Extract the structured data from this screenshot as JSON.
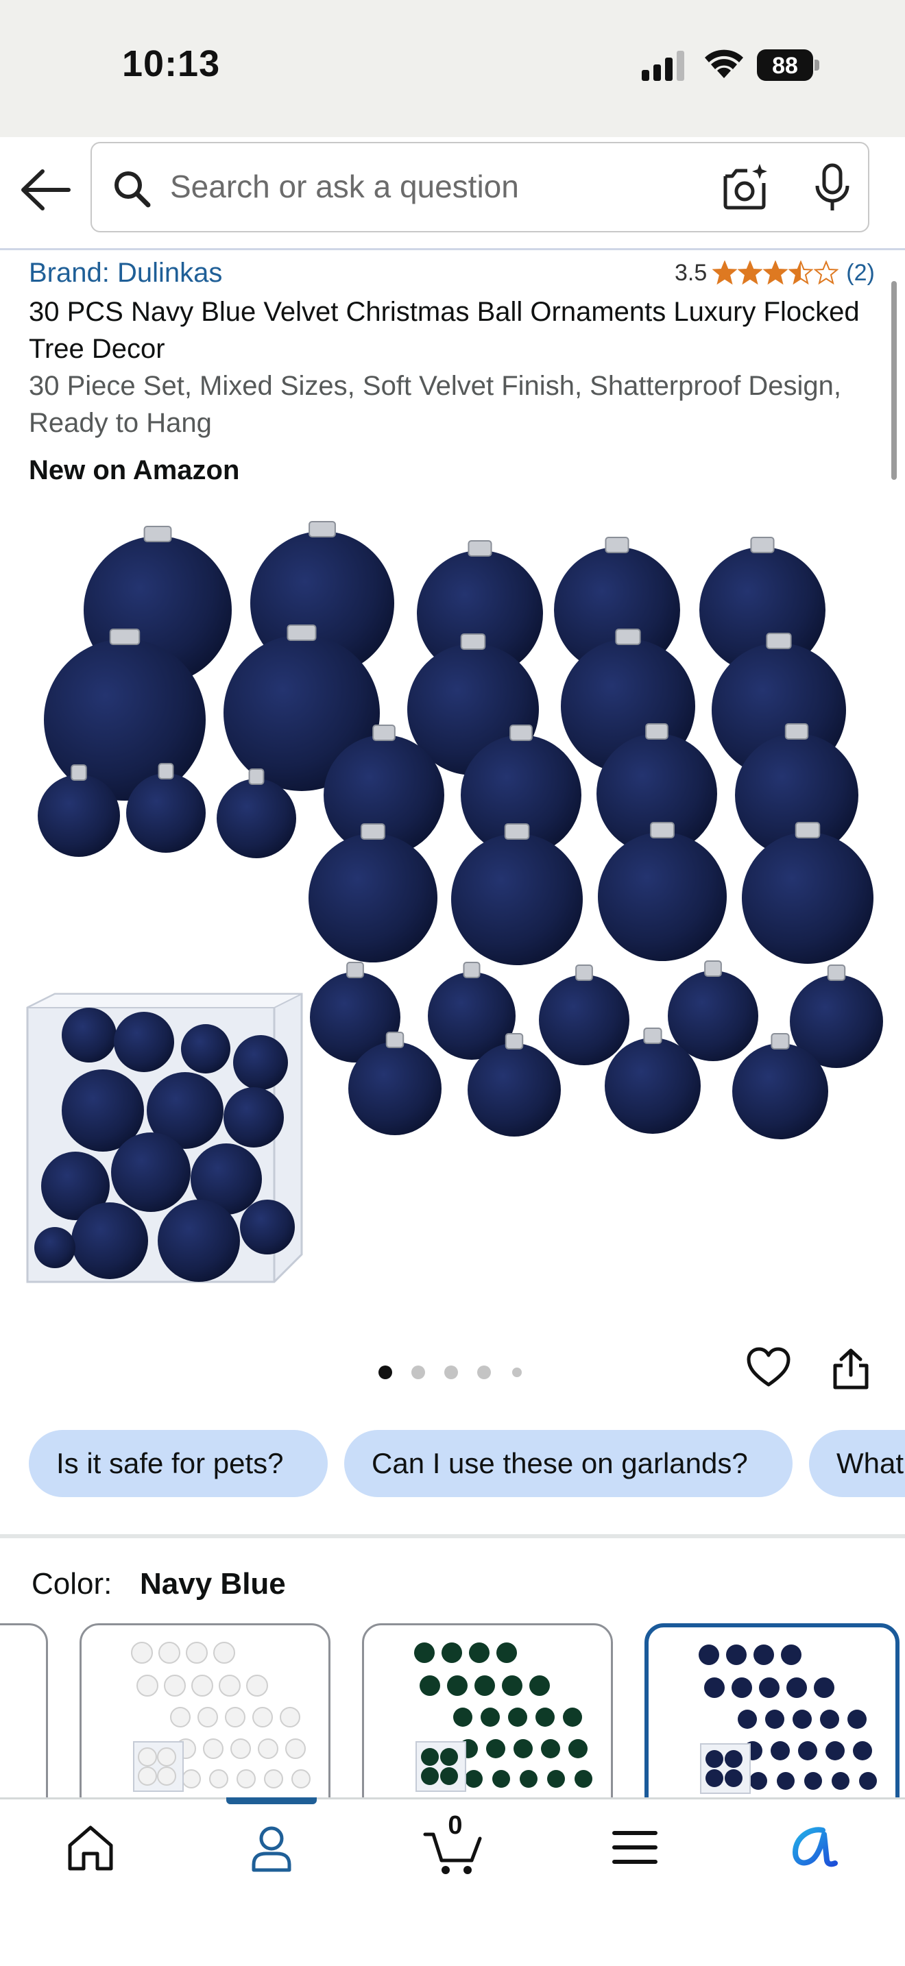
{
  "status_bar": {
    "time": "10:13",
    "battery": "88"
  },
  "search": {
    "placeholder": "Search or ask a question"
  },
  "product": {
    "brand": "Brand: Dulinkas",
    "rating": "3.5",
    "rating_stars": 3.5,
    "rating_count": "(2)",
    "title": "30 PCS Navy Blue Velvet Christmas Ball Ornaments Luxury Flocked Tree Decor",
    "subtitle": "30 Piece Set, Mixed Sizes, Soft Velvet Finish, Shatterproof Design, Ready to Hang",
    "badge": "New on Amazon",
    "image_pages": 5,
    "active_page": 1
  },
  "questions": [
    "Is it safe for pets?",
    "Can I use these on garlands?",
    "What"
  ],
  "color": {
    "label": "Color:",
    "selected": "Navy Blue",
    "swatches": [
      {
        "name": "white",
        "ball_color": "#f2f2f2"
      },
      {
        "name": "dark-green",
        "ball_color": "#0e3a27"
      },
      {
        "name": "navy-blue",
        "ball_color": "#15204a"
      }
    ]
  },
  "bottom_nav": {
    "items": [
      "home",
      "account",
      "cart",
      "menu",
      "rufus"
    ],
    "active": "account",
    "cart_count": "0"
  },
  "colors": {
    "link_blue": "#1f5f97",
    "star_orange": "#de7921",
    "chip_bg": "#c9ddf9",
    "navy_ornament": "#15204a",
    "selected_border": "#1a5a9a"
  }
}
